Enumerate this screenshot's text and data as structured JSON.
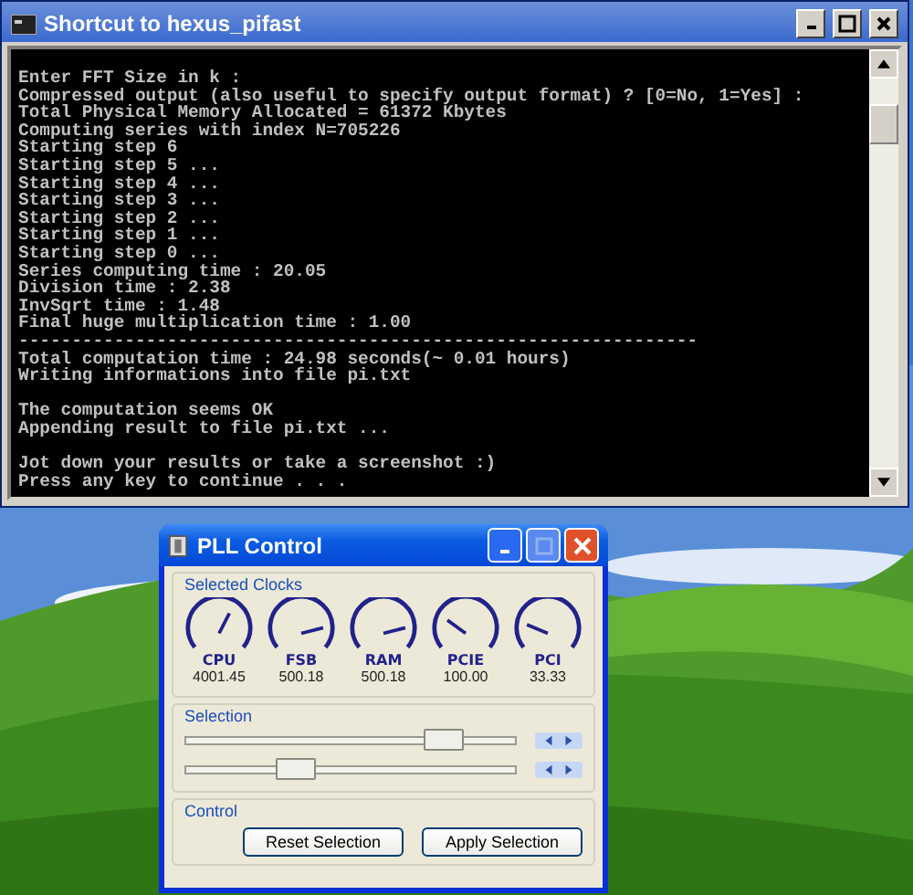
{
  "console": {
    "title": "Shortcut to hexus_pifast",
    "blocks": [
      [
        "Enter FFT Size in k :",
        "Compressed output (also useful to specify output format) ? [0=No, 1=Yes] :",
        "Total Physical Memory Allocated = 61372 Kbytes",
        "Computing series with index N=705226",
        "Starting step 6",
        "Starting step 5 ...",
        "Starting step 4 ...",
        "Starting step 3 ...",
        "Starting step 2 ...",
        "Starting step 1 ...",
        "Starting step 0 ...",
        "Series computing time : 20.05",
        "Division time : 2.38",
        "InvSqrt time : 1.48",
        "Final huge multiplication time : 1.00",
        "----------------------------------------------------------------",
        "Total computation time : 24.98 seconds(~ 0.01 hours)",
        "Writing informations into file pi.txt"
      ],
      [
        "The computation seems OK",
        "Appending result to file pi.txt ..."
      ],
      [
        "Jot down your results or take a screenshot :)",
        "Press any key to continue . . ."
      ]
    ]
  },
  "pll": {
    "title": "PLL Control",
    "clocks_group": "Selected Clocks",
    "clocks": [
      {
        "name": "CPU",
        "value": "4001.45"
      },
      {
        "name": "FSB",
        "value": "500.18"
      },
      {
        "name": "RAM",
        "value": "500.18"
      },
      {
        "name": "PCIE",
        "value": "100.00"
      },
      {
        "name": "PCI",
        "value": "33.33"
      }
    ],
    "selection_group": "Selection",
    "sliders": [
      {
        "level": 0.78
      },
      {
        "level": 0.33
      }
    ],
    "control_group": "Control",
    "buttons": [
      "Reset Selection",
      "Apply Selection"
    ]
  }
}
